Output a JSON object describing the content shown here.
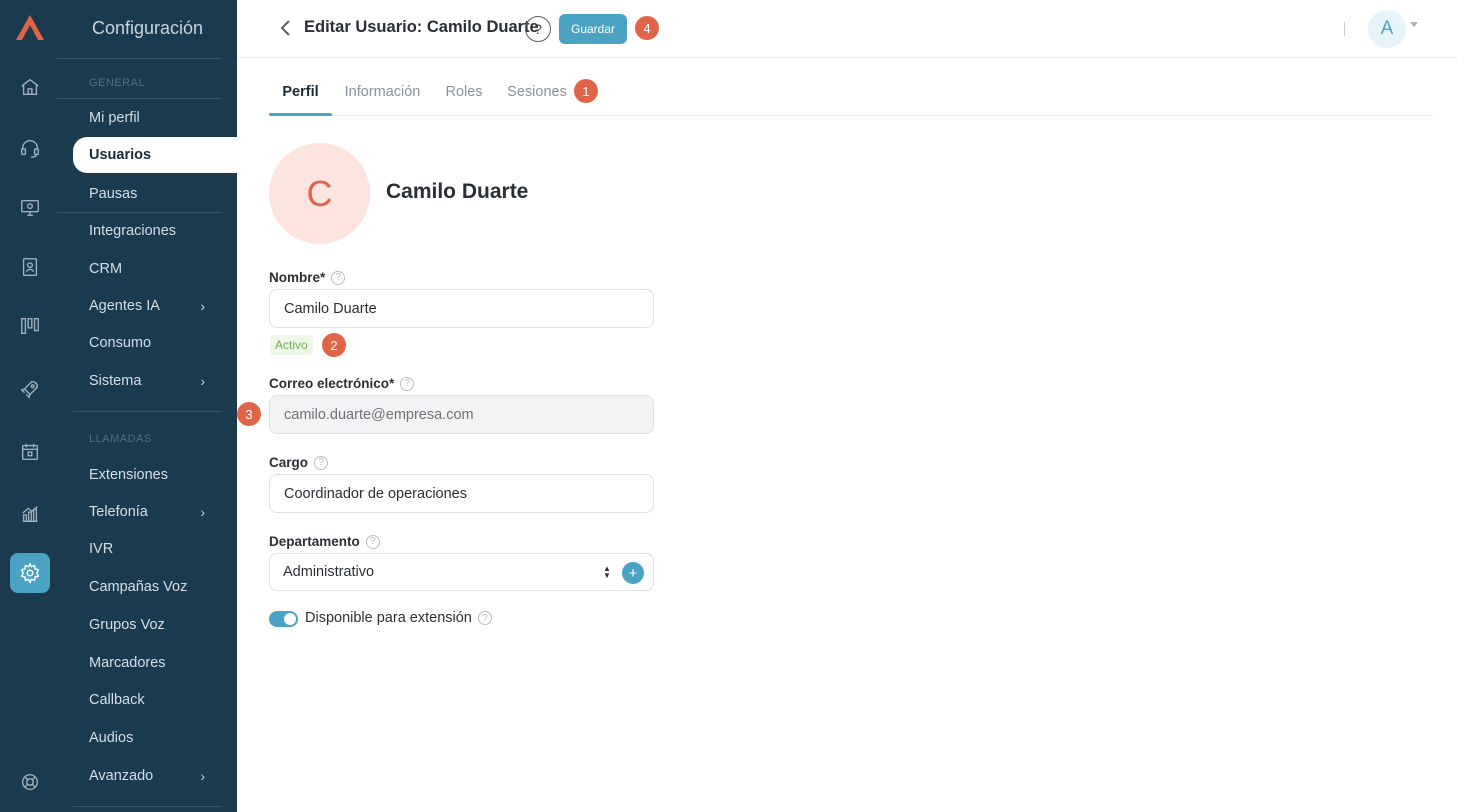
{
  "sidebar": {
    "title": "Configuración",
    "sections": {
      "general": "GENERAL",
      "llamadas": "LLAMADAS"
    },
    "items": [
      {
        "label": "Mi perfil"
      },
      {
        "label": "Usuarios"
      },
      {
        "label": "Pausas"
      },
      {
        "label": "Integraciones"
      },
      {
        "label": "CRM"
      },
      {
        "label": "Agentes IA",
        "chevron": "›"
      },
      {
        "label": "Consumo"
      },
      {
        "label": "Sistema",
        "chevron": "›"
      },
      {
        "label": "Extensiones"
      },
      {
        "label": "Telefonía",
        "chevron": "›"
      },
      {
        "label": "IVR"
      },
      {
        "label": "Campañas Voz"
      },
      {
        "label": "Grupos Voz"
      },
      {
        "label": "Marcadores"
      },
      {
        "label": "Callback"
      },
      {
        "label": "Audios"
      },
      {
        "label": "Avanzado",
        "chevron": "›"
      }
    ]
  },
  "rail": {
    "icons": [
      "home-icon",
      "headset-icon",
      "monitor-icon",
      "contacts-book-icon",
      "kanban-icon",
      "rocket-icon",
      "calendar-icon",
      "chart-icon",
      "settings-icon",
      "help-lifebuoy-icon"
    ],
    "active": "settings-icon"
  },
  "header": {
    "title": "Editar Usuario: Camilo Duarte",
    "help": "?",
    "save_label": "Guardar",
    "badge": "4",
    "avatar_letter": "A"
  },
  "tabs": [
    {
      "label": "Perfil"
    },
    {
      "label": "Información"
    },
    {
      "label": "Roles"
    },
    {
      "label": "Sesiones"
    }
  ],
  "tabs_badge": "1",
  "profile": {
    "initial": "C",
    "name": "Camilo Duarte"
  },
  "form": {
    "name_label": "Nombre*",
    "name_value": "Camilo Duarte",
    "status": "Activo",
    "status_badge": "2",
    "email_label": "Correo electrónico*",
    "email_value": "camilo.duarte@empresa.com",
    "email_badge": "3",
    "job_label": "Cargo",
    "job_value": "Coordinador de operaciones",
    "dept_label": "Departamento",
    "dept_value": "Administrativo",
    "dept_add": "+",
    "toggle_label": "Disponible para extensión",
    "help_glyph": "?"
  },
  "colors": {
    "sidebar_bg": "#1b3a4d",
    "accent": "#4ba3c3",
    "badge": "#e06448",
    "avatar_bg": "#fde4de",
    "status_green": "#6fb14a"
  }
}
